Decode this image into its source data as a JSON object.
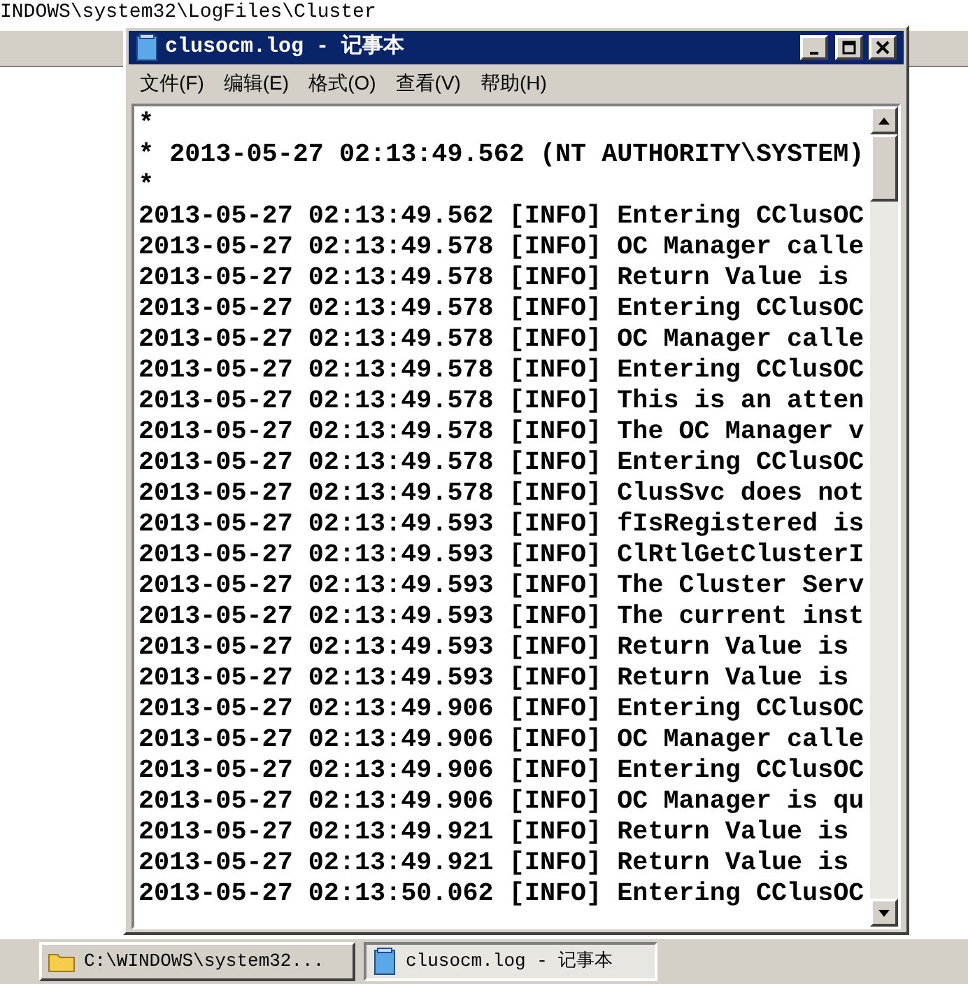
{
  "background_window": {
    "path": "INDOWS\\system32\\LogFiles\\Cluster"
  },
  "window": {
    "title": "clusocm.log - 记事本",
    "menu": [
      "文件(F)",
      "编辑(E)",
      "格式(O)",
      "查看(V)",
      "帮助(H)"
    ],
    "lines": [
      "*",
      "* 2013-05-27 02:13:49.562 (NT AUTHORITY\\SYSTEM)",
      "*",
      "2013-05-27 02:13:49.562 [INFO] Entering CClusOC",
      "2013-05-27 02:13:49.578 [INFO] OC Manager calle",
      "2013-05-27 02:13:49.578 [INFO] Return Value is",
      "2013-05-27 02:13:49.578 [INFO] Entering CClusOC",
      "2013-05-27 02:13:49.578 [INFO] OC Manager calle",
      "2013-05-27 02:13:49.578 [INFO] Entering CClusOC",
      "2013-05-27 02:13:49.578 [INFO] This is an atten",
      "2013-05-27 02:13:49.578 [INFO] The OC Manager v",
      "2013-05-27 02:13:49.578 [INFO] Entering CClusOC",
      "2013-05-27 02:13:49.578 [INFO] ClusSvc does not",
      "2013-05-27 02:13:49.593 [INFO] fIsRegistered is",
      "2013-05-27 02:13:49.593 [INFO] ClRtlGetClusterI",
      "2013-05-27 02:13:49.593 [INFO] The Cluster Serv",
      "2013-05-27 02:13:49.593 [INFO] The current inst",
      "2013-05-27 02:13:49.593 [INFO] Return Value is",
      "2013-05-27 02:13:49.593 [INFO] Return Value is",
      "2013-05-27 02:13:49.906 [INFO] Entering CClusOC",
      "2013-05-27 02:13:49.906 [INFO] OC Manager calle",
      "2013-05-27 02:13:49.906 [INFO] Entering CClusOC",
      "2013-05-27 02:13:49.906 [INFO] OC Manager is qu",
      "2013-05-27 02:13:49.921 [INFO] Return Value is",
      "2013-05-27 02:13:49.921 [INFO] Return Value is",
      "2013-05-27 02:13:50.062 [INFO] Entering CClusOC"
    ]
  },
  "taskbar": [
    {
      "kind": "folder",
      "label": "C:\\WINDOWS\\system32...",
      "selected": false
    },
    {
      "kind": "notepad",
      "label": "clusocm.log - 记事本",
      "selected": true
    }
  ]
}
